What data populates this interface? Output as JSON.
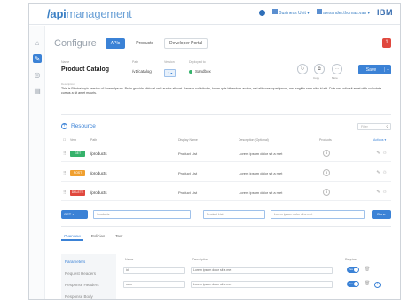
{
  "header": {
    "brand_bold": "/api",
    "brand_light": "management",
    "user_menu": "Business Unit",
    "user_name": "alexander.thomas.van",
    "ibm": "IBM"
  },
  "configure": {
    "title": "Configure",
    "tabs": [
      {
        "label": "APIs",
        "active": true
      },
      {
        "label": "Products",
        "active": false
      },
      {
        "label": "Developer Portal",
        "active": false
      }
    ],
    "alert_count": "1"
  },
  "product": {
    "name_label": "Name",
    "name": "Product Catalog",
    "path_label": "Path",
    "path": "/v1/catalog",
    "version_label": "Version",
    "version": "1",
    "deploy_label": "Deployed to",
    "deploy": "Sandbox",
    "copy_label": "Copy",
    "more_label": "More",
    "save_label": "Save",
    "description_label": "Description",
    "description": "This is Photoshop's version of Lorem Ipsum. Proin gravida nibh vel velit auctor aliquet. Aenean sollicitudin, lorem quis bibendum auctor, nisi elit consequat ipsum, nec sagittis sem nibh id elit. Duis sed odio sit amet nibh vulputate cursus a sit amet mauris."
  },
  "resources": {
    "title": "Resource",
    "filter_placeholder": "Filter",
    "columns": {
      "verb": "Verb",
      "path": "Path",
      "display_name": "Display Name",
      "description": "Description (Optional)",
      "products": "Products",
      "actions": "Actions"
    },
    "rows": [
      {
        "verb": "GET",
        "verb_color": "#35b26b",
        "path": "/products",
        "display_name": "Product List",
        "description": "Lorem ipsum dolor sit a met",
        "products": "0"
      },
      {
        "verb": "POST",
        "verb_color": "#f0a030",
        "path": "/products",
        "display_name": "Product List",
        "description": "Lorem ipsum dolor sit a met",
        "products": "0"
      },
      {
        "verb": "DELETE",
        "verb_color": "#e0483e",
        "path": "/products",
        "display_name": "Product List",
        "description": "Lorem ipsum dolor sit a met",
        "products": "0"
      }
    ],
    "add": {
      "verb": "GET",
      "path": "/products",
      "display_name": "Product List",
      "description": "Lorem ipsum dolor sit a met",
      "button": "Done"
    }
  },
  "subtabs": [
    "Overview",
    "Policies",
    "Test"
  ],
  "parameters": {
    "nav": [
      "Parameters",
      "Request Headers",
      "Response Headers",
      "Response Body"
    ],
    "columns": {
      "name": "Name",
      "description": "Description",
      "required": "Required"
    },
    "rows": [
      {
        "name": "id",
        "description": "Lorem ipsum dolor sit a met",
        "required": "Yes"
      },
      {
        "name": "num",
        "description": "Lorem ipsum dolor sit a met",
        "required": "Yes"
      }
    ]
  }
}
